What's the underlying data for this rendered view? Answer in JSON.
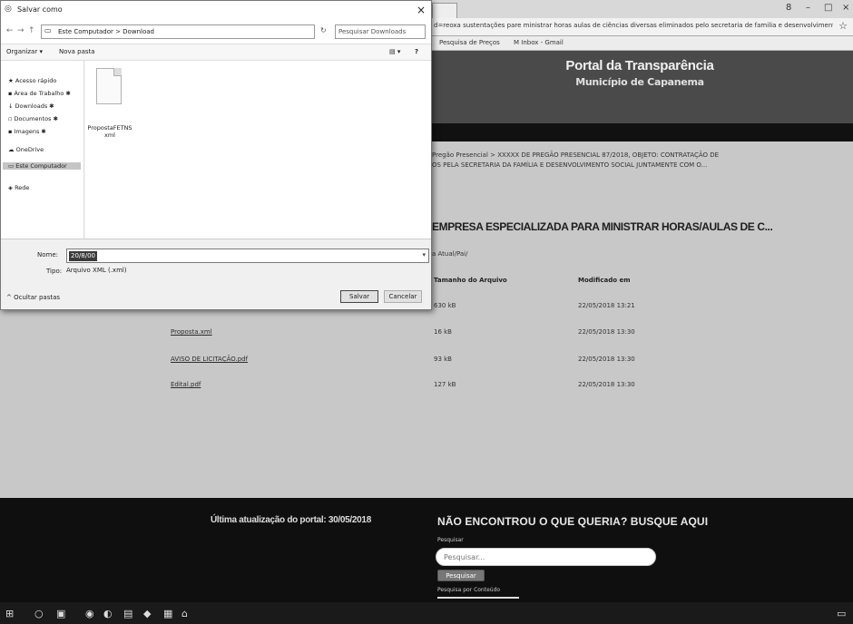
{
  "browser": {
    "window_controls": [
      "8",
      "–",
      "□",
      "×"
    ],
    "url": "d=reoxa sustentações pare ministrar horas aulas de ciências diversas eliminados pelo secretaria de familia e desenvolvimento social portal",
    "bookmarks": [
      "Pesquisa de Preços",
      "M  Inbox - Gmail"
    ],
    "site_title": "Portal da Transparência",
    "site_subtitle": "Município de Capanema",
    "breadcrumb_line1": "Pregão Presencial > XXXXX DE PREGÃO PRESENCIAL 87/2018, OBJETO: CONTRATAÇÃO DE",
    "breadcrumb_line2": "OS PELA SECRETARIA DA FAMÍLIA E DESENVOLVIMENTO SOCIAL JUNTAMENTE COM O...",
    "document_title": "EMPRESA ESPECIALIZADA PARA MINISTRAR HORAS/AULAS DE C...",
    "folder_label": "a  Atual/Pai/",
    "table": {
      "headers": [
        "Tamanho do Arquivo",
        "Modificado em"
      ],
      "rows": [
        {
          "name": "",
          "size": "630 kB",
          "modified": "22/05/2018 13:21"
        },
        {
          "name": "Proposta.xml",
          "size": "16 kB",
          "modified": "22/05/2018 13:30"
        },
        {
          "name": "AVISO DE LICITAÇÃO.pdf",
          "size": "93 kB",
          "modified": "22/05/2018 13:30"
        },
        {
          "name": "Edital.pdf",
          "size": "127 kB",
          "modified": "22/05/2018 13:30"
        }
      ]
    },
    "footer": {
      "last_update": "Última atualização do portal: 30/05/2018",
      "search_heading": "NÃO ENCONTROU O QUE QUERIA? BUSQUE AQUI",
      "search_label": "Pesquisar",
      "search_placeholder": "Pesquisar...",
      "search_button": "Pesquisar",
      "advanced_search": "Pesquisa por Conteúdo"
    }
  },
  "dialog": {
    "title": "Salvar como",
    "path": "Este Computador  >  Download",
    "search_placeholder": "Pesquisar Downloads",
    "toolbar": {
      "organize": "Organizar ▾",
      "new_folder": "Nova pasta"
    },
    "sidebar": [
      {
        "label": "Acesso rápido",
        "icon": "star-icon"
      },
      {
        "label": "Área de Trabalho",
        "icon": "desktop-icon"
      },
      {
        "label": "Downloads",
        "icon": "download-icon"
      },
      {
        "label": "Documentos",
        "icon": "document-icon"
      },
      {
        "label": "Imagens",
        "icon": "image-icon"
      },
      {
        "label": "OneDrive",
        "icon": "cloud-icon"
      },
      {
        "label": "Este Computador",
        "icon": "computer-icon"
      },
      {
        "label": "Rede",
        "icon": "network-icon"
      }
    ],
    "file": {
      "name": "PropostaFETNS xml"
    },
    "filename_label": "Nome:",
    "filename_value": "20/8/00",
    "filetype_label": "Tipo:",
    "filetype_value": "Arquivo XML (.xml)",
    "hide_folders": "^ Ocultar pastas",
    "save_button": "Salvar",
    "cancel_button": "Cancelar"
  }
}
